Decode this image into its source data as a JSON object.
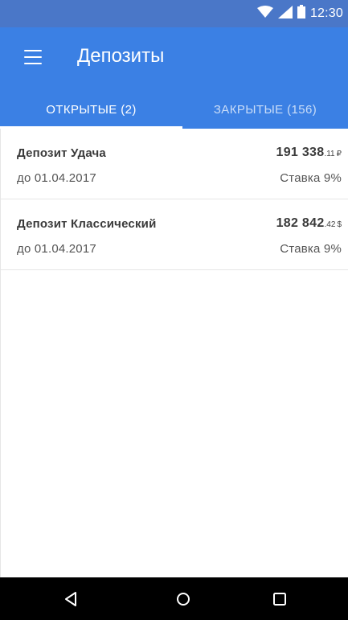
{
  "status_bar": {
    "time": "12:30",
    "icons": [
      "wifi-icon",
      "signal-icon",
      "battery-icon"
    ]
  },
  "app_bar": {
    "menu_icon": "hamburger-menu-icon",
    "title": "Депозиты"
  },
  "tabs": [
    {
      "label": "ОТКРЫТЫЕ (2)",
      "active": true
    },
    {
      "label": "ЗАКРЫТЫЕ (156)",
      "active": false
    }
  ],
  "deposits": [
    {
      "name": "Депозит Удача",
      "until": "до 01.04.2017",
      "amount_main": "191 338",
      "amount_cents": ".11",
      "currency": "₽",
      "rate": "Ставка 9%"
    },
    {
      "name": "Депозит Классический",
      "until": "до 01.04.2017",
      "amount_main": "182 842",
      "amount_cents": ".42",
      "currency": "$",
      "rate": "Ставка 9%"
    }
  ],
  "nav_bar": {
    "icons": [
      "back-icon",
      "home-icon",
      "recents-icon"
    ]
  },
  "colors": {
    "status_bar": "#4a77c8",
    "app_bar": "#3b80e4",
    "nav_bar": "#000000"
  }
}
